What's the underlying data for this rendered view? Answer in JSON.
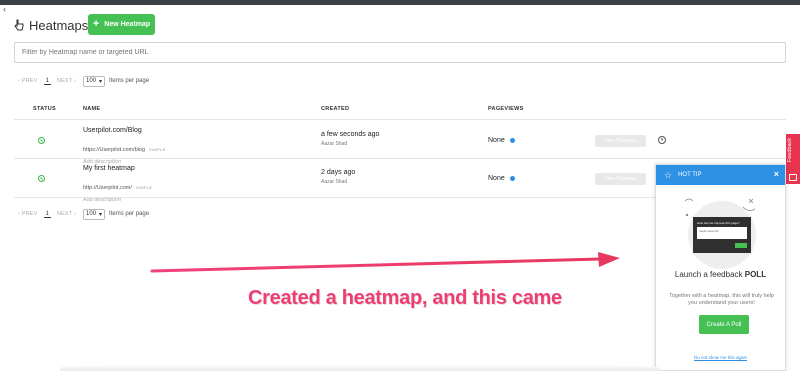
{
  "app": {
    "title": "Heatmaps",
    "new_button_label": "New Heatmap"
  },
  "search": {
    "placeholder": "Filter by Heatmap name or targeted URL"
  },
  "pagination": {
    "prev_label": "‹ PREV",
    "page": "1",
    "next_label": "NEXT ›",
    "page_size": "100",
    "items_label": "Items per page"
  },
  "table": {
    "columns": [
      "STATUS",
      "NAME",
      "CREATED",
      "PAGEVIEWS"
    ],
    "rows": [
      {
        "name": "Userpilot.com/Blog",
        "url": "https://Userpilot.com/blog",
        "match": "SIMPLE",
        "description_placeholder": "Add description",
        "created": "a few seconds ago",
        "author": "Aazar Shad",
        "pageviews": "None",
        "view_button": "View Heatmap"
      },
      {
        "name": "My first heatmap",
        "url": "http://Userpilot.com/",
        "match": "SIMPLE",
        "description_placeholder": "Add description",
        "created": "2 days ago",
        "author": "Aazar Shad",
        "pageviews": "None",
        "view_button": "View Heatmap"
      }
    ]
  },
  "feedback_tab": {
    "label": "Feedback"
  },
  "hot_tip": {
    "header": "HOT TIP",
    "title_prefix": "Launch a feedback ",
    "title_bold": "POLL",
    "text": "Together with a heatmap, this will truly help you understand your users!",
    "button": "Create A Poll",
    "dismiss": "Do not show me this again",
    "illustration_question": "How can we improve this page?",
    "illustration_answer": "Usually sweet this!"
  },
  "annotation": {
    "text": "Created a heatmap, and this came"
  },
  "colors": {
    "accent_green": "#45c154",
    "tip_blue": "#2d91e6",
    "annotation_pink": "#ef3d72",
    "feedback_red": "#e8344f"
  }
}
